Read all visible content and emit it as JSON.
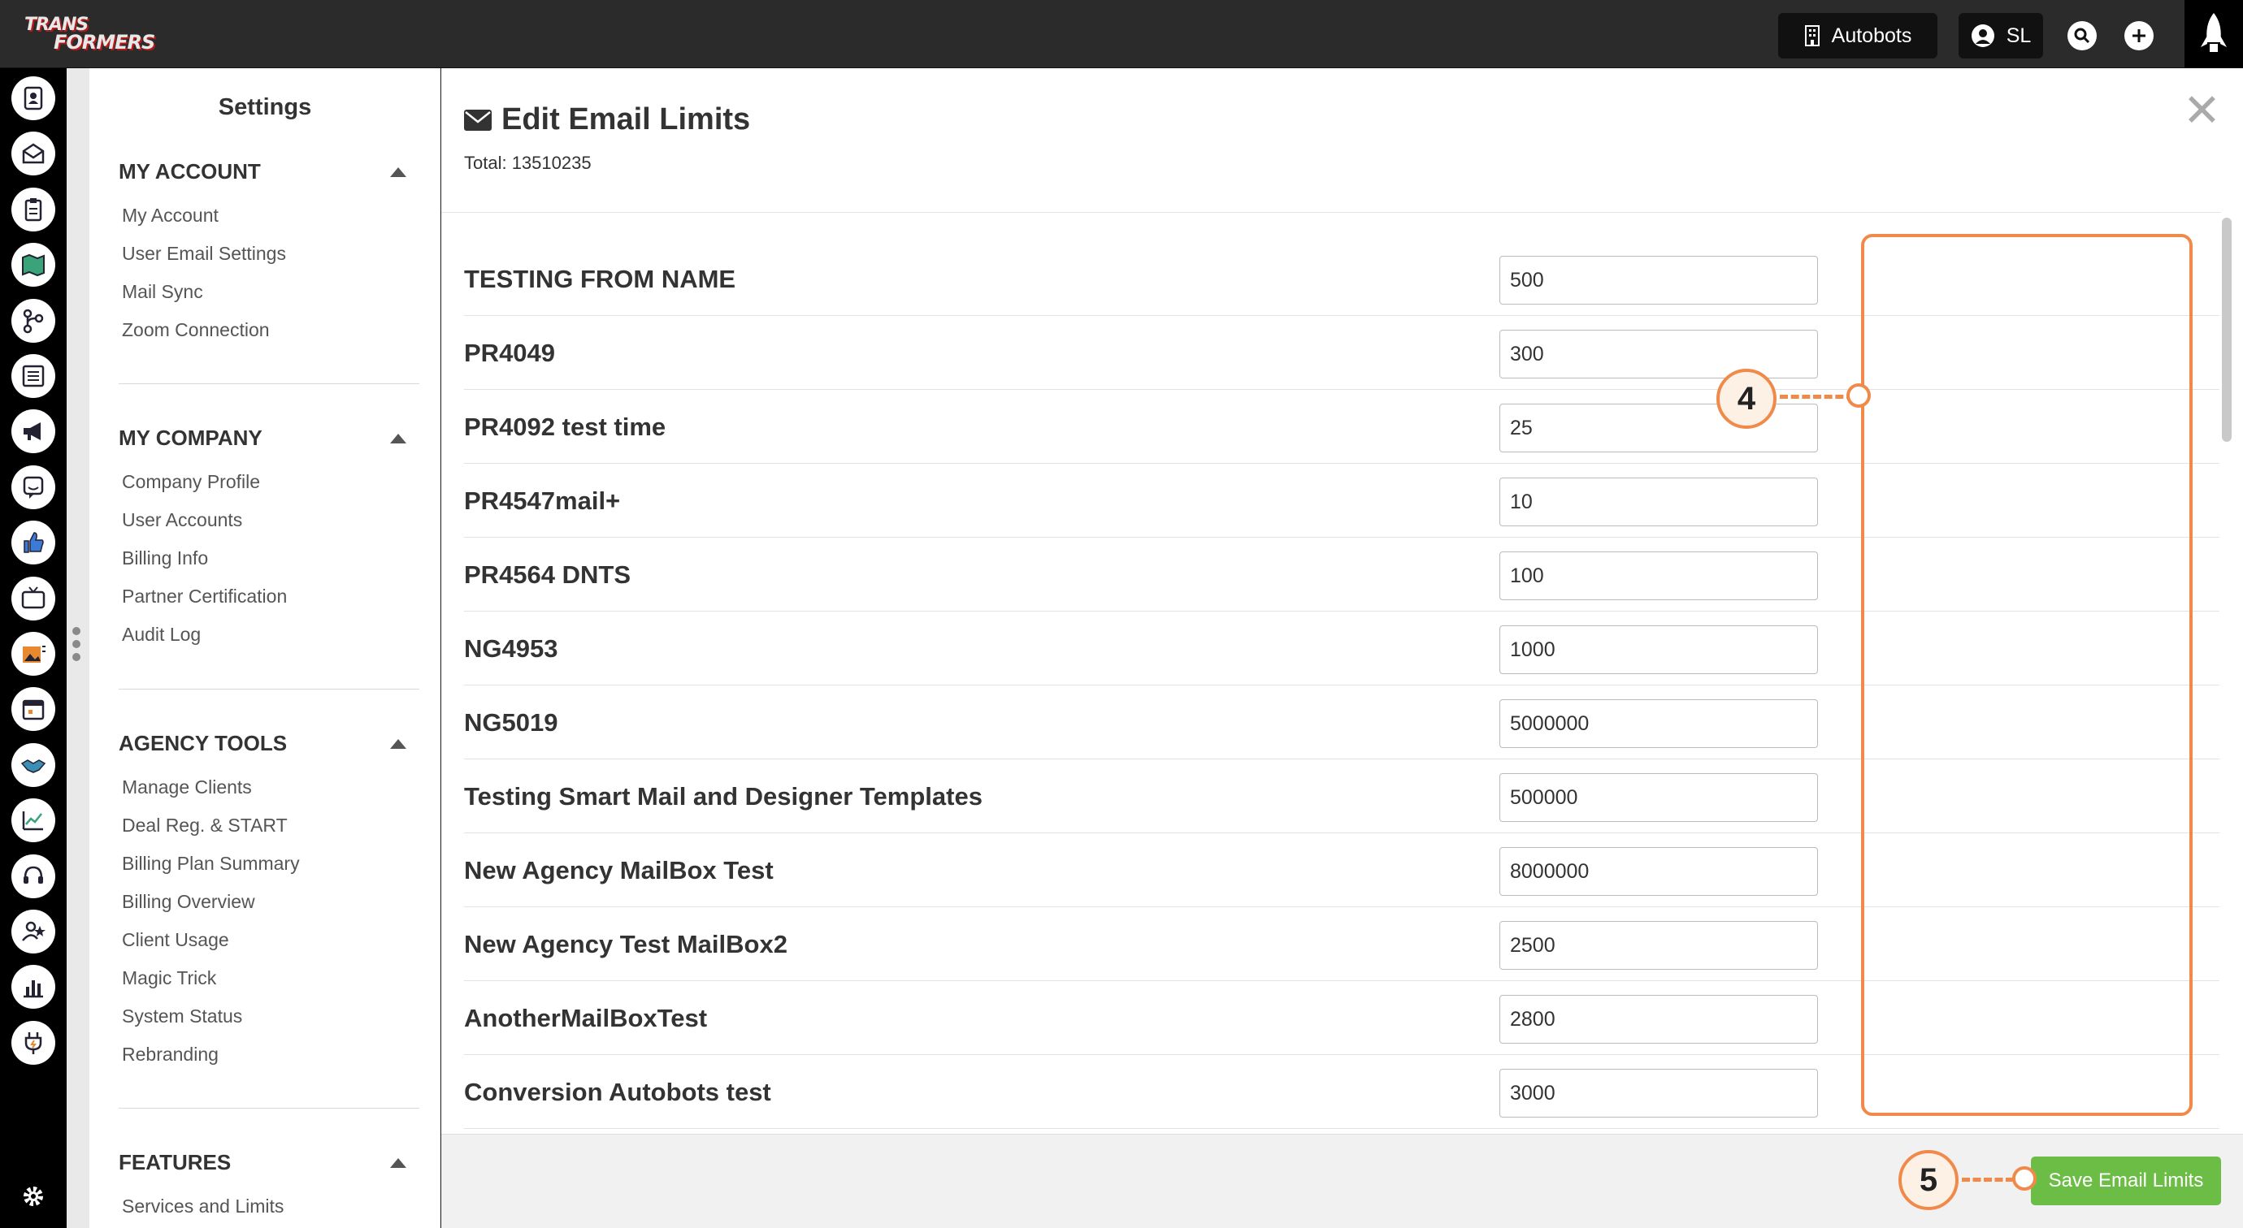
{
  "topbar": {
    "logo_line1": "TRANS",
    "logo_line2": "FORMERS",
    "agency_label": "Autobots",
    "user_initials": "SL"
  },
  "rail_icons": [
    "contacts-icon",
    "email-icon",
    "clipboard-icon",
    "map-icon",
    "workflow-icon",
    "list-icon",
    "megaphone-icon",
    "chat-bot-icon",
    "thumbs-up-icon",
    "tv-icon",
    "media-icon",
    "calendar-icon",
    "handshake-icon",
    "analytics-icon",
    "support-icon",
    "user-star-icon",
    "reports-icon",
    "plug-icon"
  ],
  "settings": {
    "title": "Settings",
    "sections": [
      {
        "title": "MY ACCOUNT",
        "items": [
          "My Account",
          "User Email Settings",
          "Mail Sync",
          "Zoom Connection"
        ]
      },
      {
        "title": "MY COMPANY",
        "items": [
          "Company Profile",
          "User Accounts",
          "Billing Info",
          "Partner Certification",
          "Audit Log"
        ]
      },
      {
        "title": "AGENCY TOOLS",
        "items": [
          "Manage Clients",
          "Deal Reg. & START",
          "Billing Plan Summary",
          "Billing Overview",
          "Client Usage",
          "Magic Trick",
          "System Status",
          "Rebranding"
        ]
      },
      {
        "title": "FEATURES",
        "items": [
          "Services and Limits"
        ]
      }
    ]
  },
  "modal": {
    "title": "Edit Email Limits",
    "total": "Total: 13510235",
    "rows": [
      {
        "name": "TESTING FROM NAME",
        "value": "500"
      },
      {
        "name": "PR4049",
        "value": "300"
      },
      {
        "name": "PR4092 test time",
        "value": "25"
      },
      {
        "name": "PR4547mail+",
        "value": "10"
      },
      {
        "name": "PR4564 DNTS",
        "value": "100"
      },
      {
        "name": "NG4953",
        "value": "1000"
      },
      {
        "name": "NG5019",
        "value": "5000000"
      },
      {
        "name": "Testing Smart Mail and Designer Templates",
        "value": "500000"
      },
      {
        "name": "New Agency MailBox Test",
        "value": "8000000"
      },
      {
        "name": "New Agency Test MailBox2",
        "value": "2500"
      },
      {
        "name": "AnotherMailBoxTest",
        "value": "2800"
      },
      {
        "name": "Conversion Autobots test",
        "value": "3000"
      }
    ],
    "save_label": "Save Email Limits"
  },
  "callouts": {
    "step4": "4",
    "step5": "5"
  },
  "colors": {
    "accent": "#f08a4b",
    "save_green": "#6cbd45",
    "topbar": "#2b2b2b"
  }
}
